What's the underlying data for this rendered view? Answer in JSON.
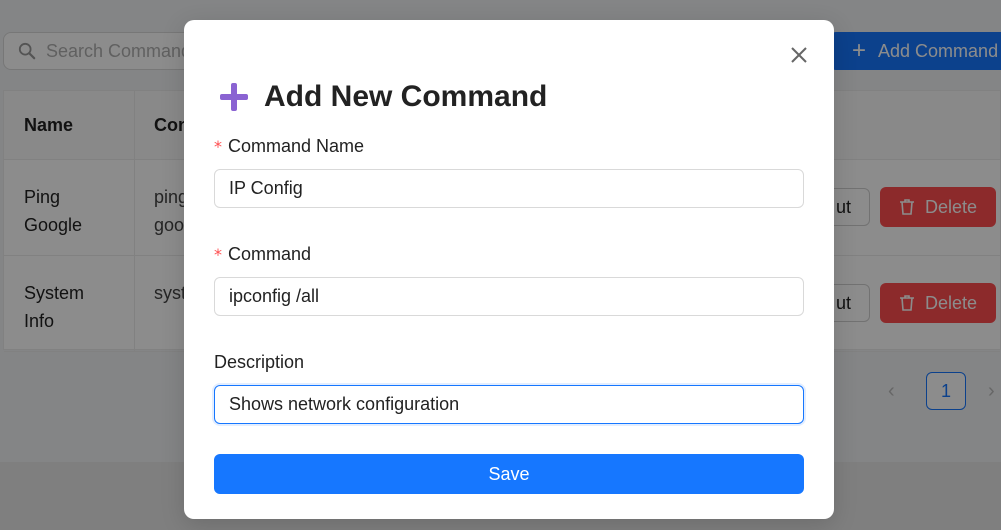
{
  "search": {
    "placeholder": "Search Command"
  },
  "toolbar": {
    "add_label": "Add Command"
  },
  "table": {
    "headers": {
      "name": "Name",
      "command": "Con"
    },
    "rows": [
      {
        "name": "Ping Google",
        "command": "ping goo",
        "edit": "ut",
        "delete": "Delete"
      },
      {
        "name": "System Info",
        "command": "syst",
        "edit": "ut",
        "delete": "Delete"
      }
    ]
  },
  "pagination": {
    "current": "1",
    "prev": "‹",
    "next": "›"
  },
  "modal": {
    "title": "Add New Command",
    "close_glyph": "×",
    "fields": {
      "name": {
        "label": "Command Name",
        "required_mark": "*",
        "value": "IP Config"
      },
      "command": {
        "label": "Command",
        "required_mark": "*",
        "value": "ipconfig /all"
      },
      "description": {
        "label": "Description",
        "value": "Shows network configuration"
      }
    },
    "save_label": "Save"
  },
  "colors": {
    "primary": "#1677ff",
    "danger": "#ff4d4f",
    "accent_purple": "#8a63d2"
  }
}
